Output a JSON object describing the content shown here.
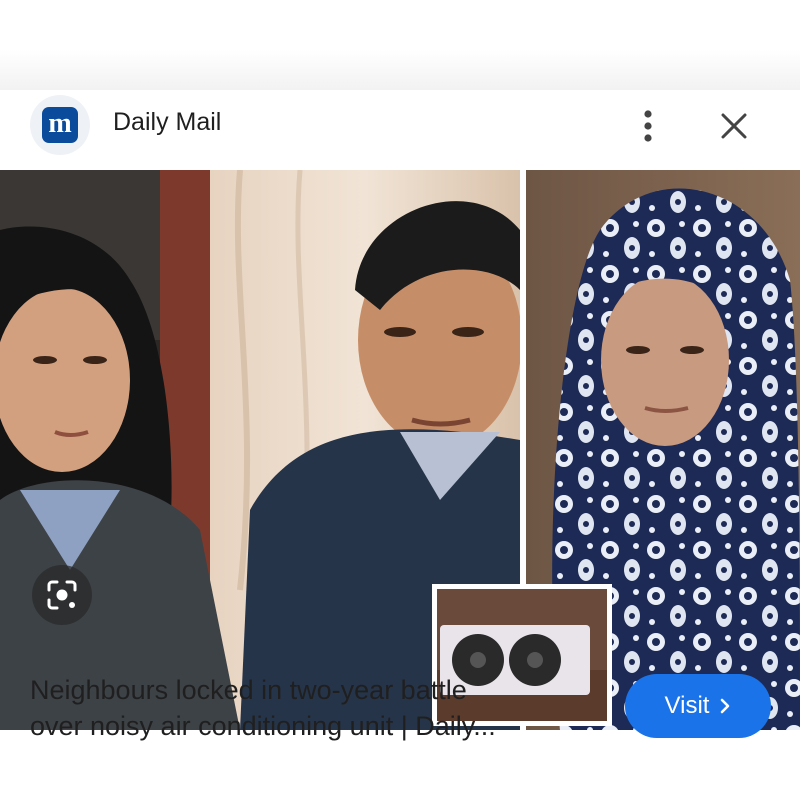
{
  "header": {
    "logo_letter": "m",
    "source_name": "Daily Mail"
  },
  "icons": {
    "more": "more-vert-icon",
    "close": "close-icon",
    "lens": "google-lens-icon",
    "chevron": "chevron-right-icon"
  },
  "footer": {
    "caption_line1": "Neighbours locked in two-year battle",
    "caption_line2": "over noisy air conditioning unit | Daily...",
    "visit_label": "Visit"
  },
  "colors": {
    "accent": "#1a73e8",
    "brand": "#0a4b9c"
  }
}
